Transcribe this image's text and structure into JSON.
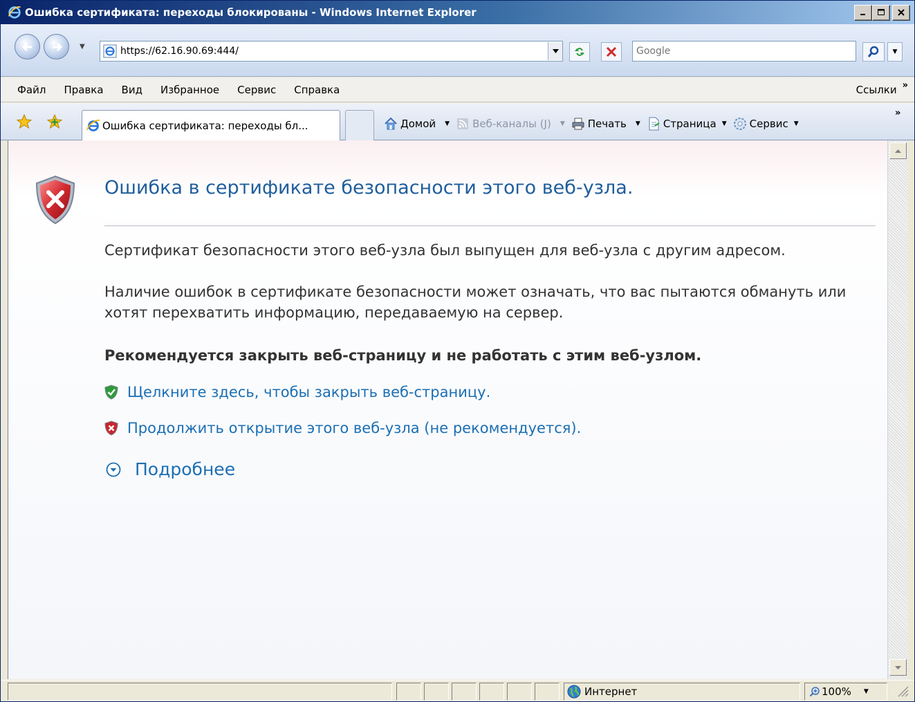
{
  "window": {
    "title": "Ошибка сертификата: переходы блокированы - Windows Internet Explorer"
  },
  "addressbar": {
    "url": "https://62.16.90.69:444/",
    "search_placeholder": "Google"
  },
  "menu": {
    "items": [
      "Файл",
      "Правка",
      "Вид",
      "Избранное",
      "Сервис",
      "Справка"
    ],
    "links_label": "Ссылки",
    "chevron": "»"
  },
  "tabs": {
    "active_label": "Ошибка сертификата: переходы бл..."
  },
  "commandbar": {
    "home": "Домой",
    "feeds": "Веб-каналы (J)",
    "print": "Печать",
    "page": "Страница",
    "tools": "Сервис",
    "chevron": "»"
  },
  "page": {
    "heading": "Ошибка в сертификате безопасности этого веб-узла.",
    "para1": "Сертификат безопасности этого веб-узла был выпущен для веб-узла с другим адресом.",
    "para2": "Наличие ошибок в сертификате безопасности может означать, что вас пытаются обмануть или хотят перехватить информацию, передаваемую на сервер.",
    "recommendation": "Рекомендуется закрыть веб-страницу и не работать с этим веб-узлом.",
    "link_close": "Щелкните здесь, чтобы закрыть веб-страницу.",
    "link_continue": "Продолжить открытие этого веб-узла (не рекомендуется).",
    "more_info": "Подробнее"
  },
  "statusbar": {
    "zone": "Интернет",
    "zoom": "100%"
  },
  "colors": {
    "heading": "#1f5e9c",
    "link": "#1c6fb3",
    "error_red": "#c8262e",
    "safe_green": "#2e9b3a"
  }
}
